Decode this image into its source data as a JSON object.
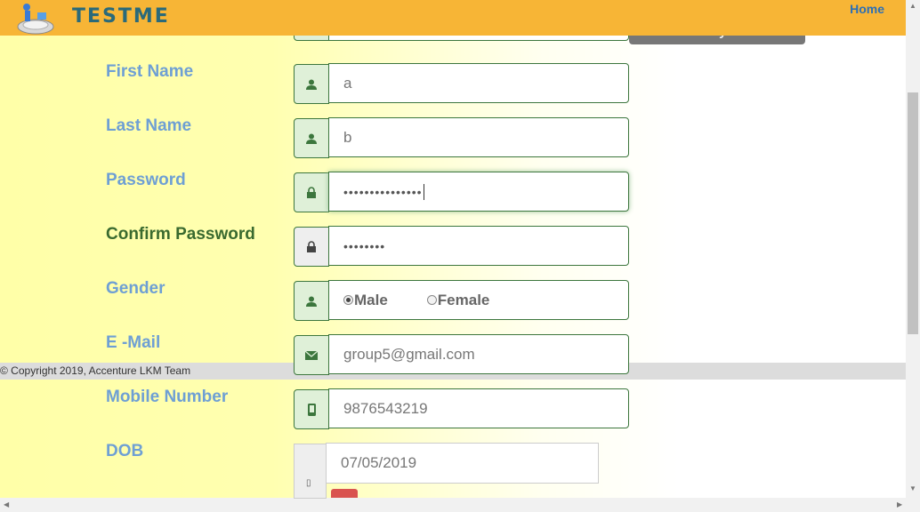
{
  "header": {
    "logo_text": "TESTME",
    "home_link": "Home"
  },
  "tooltip": {
    "text": "Name Already Exists"
  },
  "form": {
    "first_name": {
      "label": "First Name",
      "value": "a",
      "icon": "user-icon"
    },
    "last_name": {
      "label": "Last Name",
      "value": "b",
      "icon": "user-icon"
    },
    "password": {
      "label": "Password",
      "value": "•••••••••••••••",
      "icon": "lock-icon"
    },
    "confirm_password": {
      "label": "Confirm Password",
      "value": "••••••••",
      "icon": "lock-icon"
    },
    "gender": {
      "label": "Gender",
      "options": [
        "Male",
        "Female"
      ],
      "selected": "Male",
      "icon": "user-icon"
    },
    "email": {
      "label": "E -Mail",
      "value": "group5@gmail.com",
      "icon": "envelope-icon"
    },
    "mobile": {
      "label": "Mobile Number",
      "value": "9876543219",
      "icon": "mobile-icon"
    },
    "dob": {
      "label": "DOB",
      "value": "07/05/2019",
      "icon": "calendar-icon"
    }
  },
  "footer": {
    "copyright": "© Copyright 2019, Accenture LKM Team"
  },
  "colors": {
    "header_bg": "#f7b536",
    "label_color": "#6e9fd4",
    "success_border": "#3c763d",
    "addon_bg": "#dff0d8"
  }
}
